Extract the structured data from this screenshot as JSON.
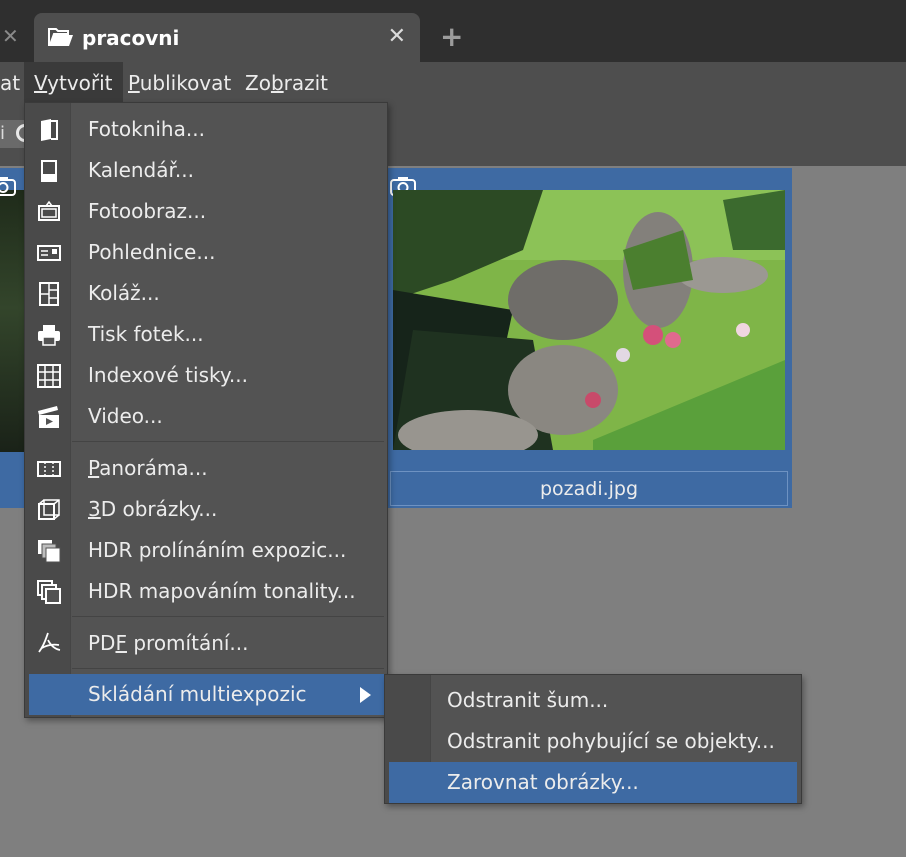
{
  "tabs": {
    "active_title": "pracovni"
  },
  "menubar": {
    "items": [
      {
        "pre": "",
        "ul": "",
        "post": "at"
      },
      {
        "pre": "",
        "ul": "V",
        "post": "ytvořit"
      },
      {
        "pre": "",
        "ul": "P",
        "post": "ublikovat"
      },
      {
        "pre": "Zo",
        "ul": "b",
        "post": "razit"
      }
    ]
  },
  "toolbar": {
    "left_fragment": "i"
  },
  "thumbnail": {
    "filename": "pozadi.jpg"
  },
  "create_menu": {
    "items": [
      {
        "pre": "Fotokniha...",
        "ul": "",
        "post": "",
        "icon": "photobook-icon"
      },
      {
        "pre": "Kalendář...",
        "ul": "",
        "post": "",
        "icon": "calendar-icon"
      },
      {
        "pre": "Fotoobraz...",
        "ul": "",
        "post": "",
        "icon": "canvas-print-icon"
      },
      {
        "pre": "Pohlednice...",
        "ul": "",
        "post": "",
        "icon": "postcard-icon"
      },
      {
        "pre": "Koláž...",
        "ul": "",
        "post": "",
        "icon": "collage-icon"
      },
      {
        "pre": "Tisk fotek...",
        "ul": "",
        "post": "",
        "icon": "printer-icon"
      },
      {
        "pre": "Indexové tisky...",
        "ul": "",
        "post": "",
        "icon": "grid-icon"
      },
      {
        "pre": "Video...",
        "ul": "",
        "post": "",
        "icon": "video-icon"
      },
      {
        "pre": "",
        "ul": "P",
        "post": "anoráma...",
        "icon": "panorama-icon"
      },
      {
        "pre": "",
        "ul": "3",
        "post": "D obrázky...",
        "icon": "3d-cube-icon"
      },
      {
        "pre": "HDR prolínáním expozic...",
        "ul": "",
        "post": "",
        "icon": "hdr-blend-icon"
      },
      {
        "pre": "HDR mapováním tonality...",
        "ul": "",
        "post": "",
        "icon": "hdr-tonemap-icon"
      },
      {
        "pre": "PD",
        "ul": "F",
        "post": " promítání...",
        "icon": "pdf-icon"
      },
      {
        "pre": "Skládání multiexpozic",
        "ul": "",
        "post": "",
        "icon": ""
      }
    ]
  },
  "submenu": {
    "items": [
      {
        "label": "Odstranit šum..."
      },
      {
        "label": "Odstranit pohybující se objekty..."
      },
      {
        "label": "Zarovnat obrázky..."
      }
    ]
  },
  "colors": {
    "highlight": "#3e6aa3",
    "menu_bg": "#535353",
    "titlebar_bg": "#2f2f2f",
    "canvas_bg": "#7f7f7f"
  }
}
